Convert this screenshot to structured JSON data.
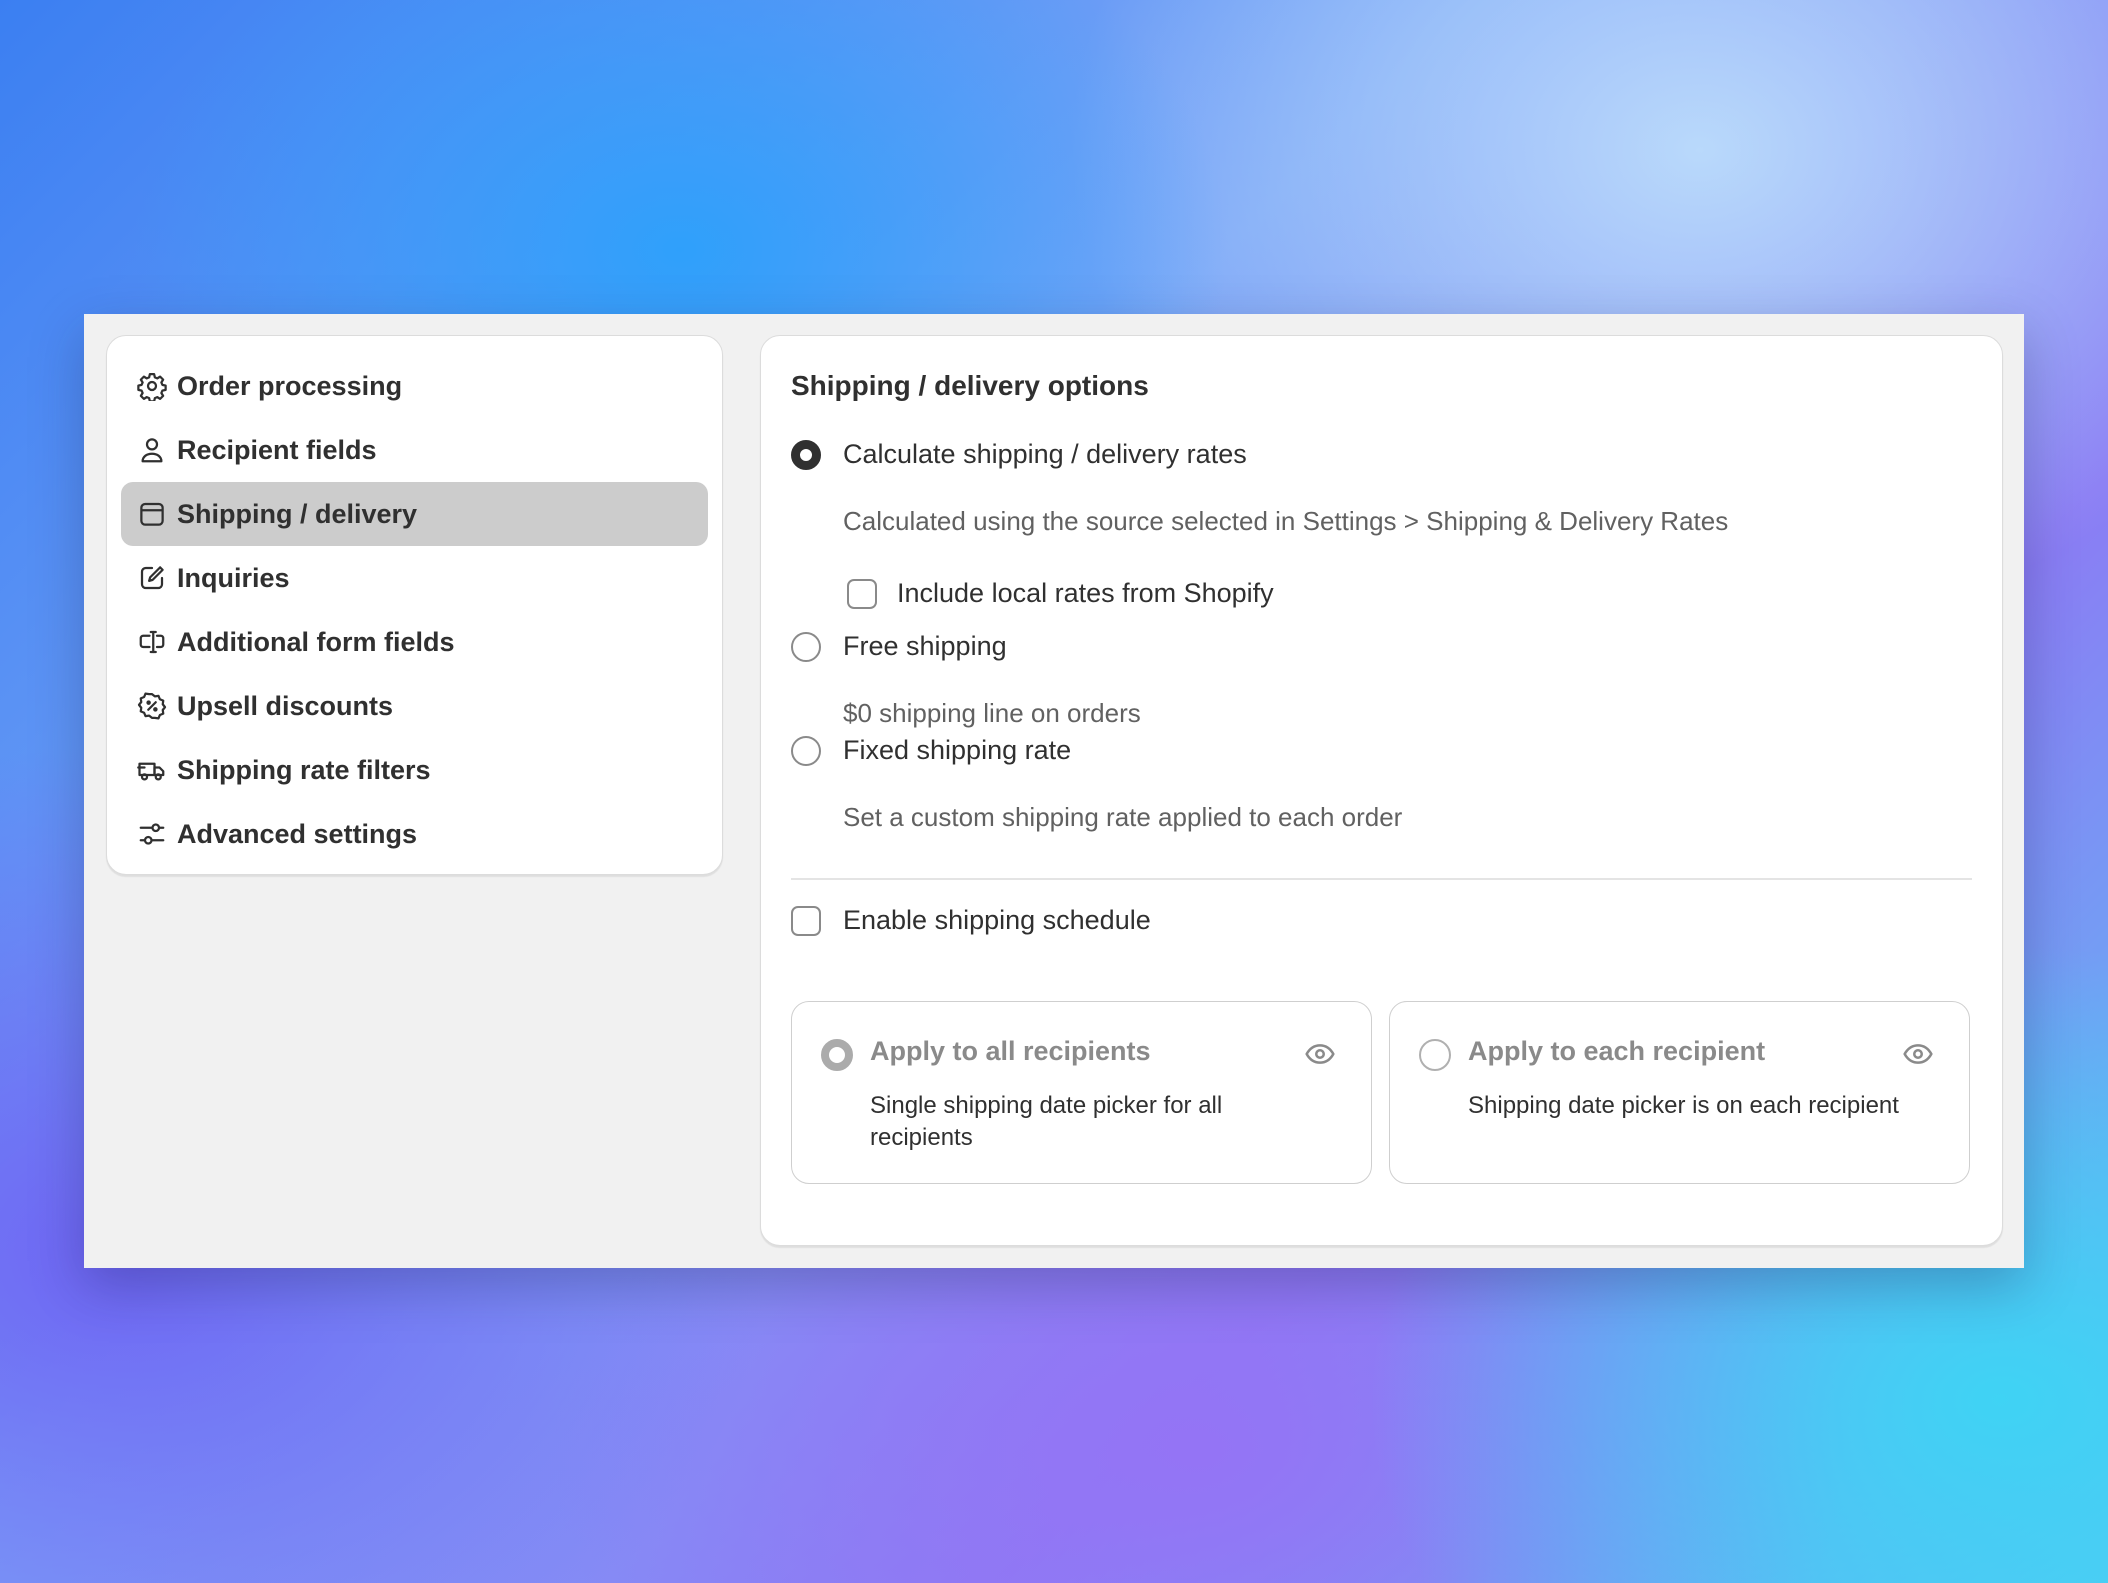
{
  "sidebar": {
    "items": [
      {
        "label": "Order processing",
        "icon": "gear-icon"
      },
      {
        "label": "Recipient fields",
        "icon": "person-icon"
      },
      {
        "label": "Shipping / delivery",
        "icon": "calendar-icon",
        "active": true
      },
      {
        "label": "Inquiries",
        "icon": "edit-icon"
      },
      {
        "label": "Additional form fields",
        "icon": "form-field-icon"
      },
      {
        "label": "Upsell discounts",
        "icon": "discount-icon"
      },
      {
        "label": "Shipping rate filters",
        "icon": "truck-icon"
      },
      {
        "label": "Advanced settings",
        "icon": "sliders-icon"
      }
    ]
  },
  "main": {
    "title": "Shipping / delivery options",
    "options": [
      {
        "label": "Calculate shipping / delivery rates",
        "help": "Calculated using the source selected in Settings > Shipping & Delivery Rates",
        "selected": true
      },
      {
        "label": "Free shipping",
        "help": "$0 shipping line on orders",
        "selected": false
      },
      {
        "label": "Fixed shipping rate",
        "help": "Set a custom shipping rate applied to each order",
        "selected": false
      }
    ],
    "include_local_rates": {
      "label": "Include local rates from Shopify",
      "checked": false
    },
    "enable_schedule": {
      "label": "Enable shipping schedule",
      "checked": false
    },
    "cards": [
      {
        "title": "Apply to all recipients",
        "desc": "Single shipping date picker for all recipients",
        "selected": true,
        "disabled": true
      },
      {
        "title": "Apply to each recipient",
        "desc": "Shipping date picker is on each recipient",
        "selected": false,
        "disabled": true
      }
    ]
  },
  "colors": {
    "text": "#303030",
    "subdued_text": "#616161",
    "active_nav_bg": "#cccccc",
    "panel_bg": "#f1f1f1"
  }
}
